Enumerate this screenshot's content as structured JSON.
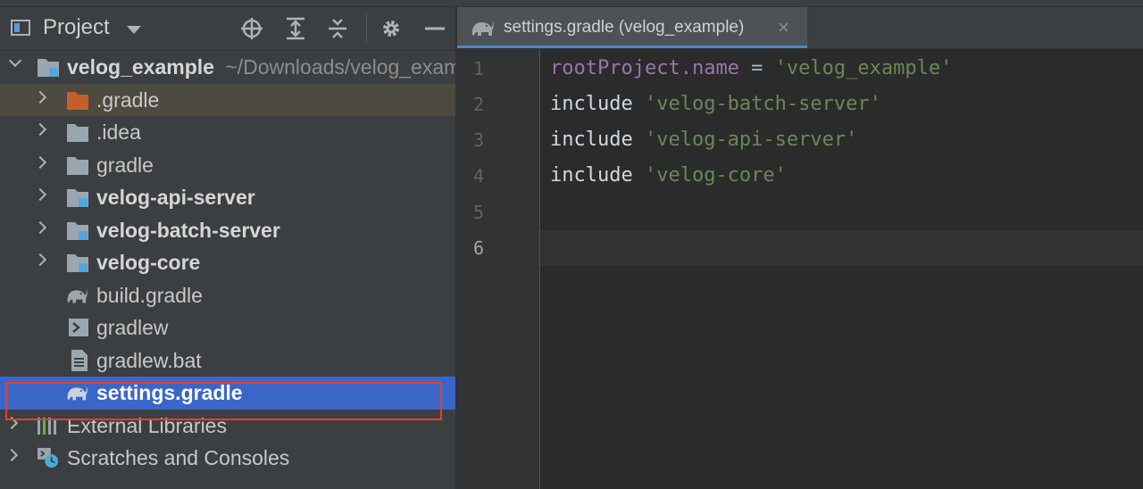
{
  "project_panel": {
    "title": "Project",
    "toolbar": {
      "locate_tooltip": "locate",
      "expand": "expand-all",
      "collapse": "collapse-all",
      "settings": "settings",
      "hide": "hide"
    },
    "root": {
      "name": "velog_example",
      "path": "~/Downloads/velog_example"
    },
    "items": [
      {
        "label": ".gradle",
        "icon": "folder-orange-icon"
      },
      {
        "label": ".idea",
        "icon": "folder-icon"
      },
      {
        "label": "gradle",
        "icon": "folder-icon"
      },
      {
        "label": "velog-api-server",
        "icon": "module-folder-icon"
      },
      {
        "label": "velog-batch-server",
        "icon": "module-folder-icon"
      },
      {
        "label": "velog-core",
        "icon": "module-folder-icon"
      },
      {
        "label": "build.gradle",
        "icon": "gradle-elephant-icon"
      },
      {
        "label": "gradlew",
        "icon": "shell-script-icon"
      },
      {
        "label": "gradlew.bat",
        "icon": "text-file-icon"
      },
      {
        "label": "settings.gradle",
        "icon": "gradle-elephant-icon"
      }
    ],
    "external_libraries": "External Libraries",
    "scratches": "Scratches and Consoles"
  },
  "editor": {
    "tab_title": "settings.gradle (velog_example)",
    "tab_close": "×",
    "line_numbers": [
      "1",
      "2",
      "3",
      "4",
      "5",
      "6"
    ],
    "lines": {
      "l1_a": "rootProject",
      "l1_b": ".name",
      "l1_c": " = ",
      "l1_d": "'velog_example'",
      "l2_kw": "include",
      "l2_str": "'velog-batch-server'",
      "l3_kw": "include",
      "l3_str": "'velog-api-server'",
      "l4_kw": "include",
      "l4_str": "'velog-core'"
    }
  },
  "colors": {
    "selection": "#3a66c8",
    "highlight_box": "#e0412e",
    "string": "#6a8759",
    "property": "#9876aa"
  }
}
